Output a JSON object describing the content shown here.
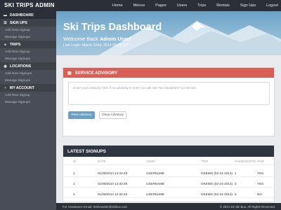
{
  "brand": "SKI TRIPS ADMIN",
  "nav": [
    "Home",
    "Menus",
    "Pages",
    "Users",
    "Trips",
    "Rentals",
    "Sign Ups",
    "Logout"
  ],
  "sidebar": {
    "dashboard": "DASHBOARD",
    "sections": [
      {
        "title": "SIGN UPS",
        "icon": "list-icon",
        "glyph": "☰",
        "links": [
          "Add New Signup",
          "Manage Signups"
        ]
      },
      {
        "title": "TRIPS",
        "icon": "pin-icon",
        "glyph": "●",
        "links": [
          "Add New Signup",
          "Manage Signups"
        ]
      },
      {
        "title": "LOCATIONS",
        "icon": "globe-icon",
        "glyph": "◍",
        "links": [
          "Add New Signups",
          "Manage Signups"
        ]
      },
      {
        "title": "MY ACCOUNT",
        "icon": "user-icon",
        "glyph": "▪",
        "links": [
          "Add New Signup",
          "Manage Signups"
        ]
      }
    ]
  },
  "hero": {
    "title": "Ski Trips Dashboard",
    "welcome_prefix": "Welcome Back ",
    "welcome_user": "Admin User!",
    "last_login": "Last Login: March 02nd, 2014  09:25 PM"
  },
  "advisory": {
    "title": "SERVICE ADVISORY",
    "icon": "printer-icon",
    "placeholder": "Enter your Advisory here if no advisory is enter you will see \"No Advisories\" on the site.",
    "post_label": "Post Advisory",
    "clear_label": "Clear Advisory"
  },
  "signups": {
    "title": "LATEST SIGNUPS",
    "columns": [
      "ID",
      "DATE",
      "USER",
      "TRIP",
      "PASSENGERS",
      "PAID"
    ],
    "rows": [
      [
        "1",
        "01/08/2014 12:32:48",
        "USERNAME",
        "OKEMO (02-24-2014)",
        "1",
        "YES"
      ],
      [
        "1",
        "01/08/2014 12:32:48",
        "USERNAME",
        "OKEMO (02-24-2014)",
        "3",
        "YES"
      ],
      [
        "1",
        "01/08/2014 12:32:48",
        "USERNAME",
        "OKEMO (02-24-2014)",
        "5",
        "NO"
      ]
    ]
  },
  "footer": {
    "left": "For Assistance Email: Webmaster@skibus.com",
    "right": "© 2014 SZ Ski Bus. All Rights Reserved."
  },
  "colors": {
    "topbar": "#2b3038",
    "sidebar": "#484d57",
    "advisory": "#d95e57",
    "accent": "#6a9fc4"
  }
}
